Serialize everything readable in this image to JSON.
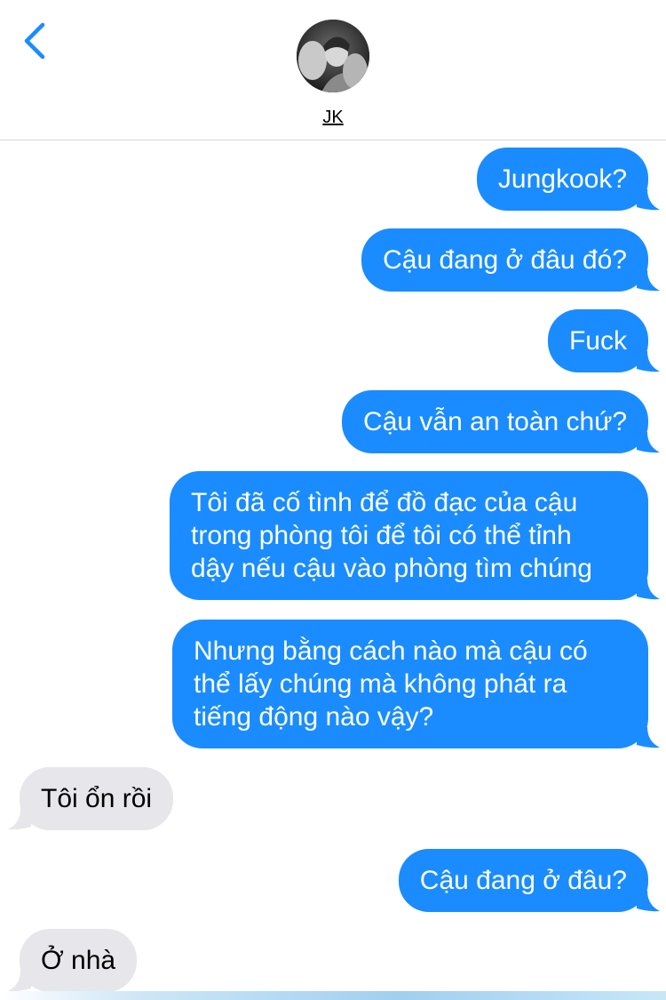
{
  "header": {
    "contact_name": "JK",
    "back_icon": "chevron-left-icon",
    "accent_color": "#1a8cff"
  },
  "messages": [
    {
      "direction": "outgoing",
      "text": "Jungkook?"
    },
    {
      "direction": "outgoing",
      "text": "Cậu đang ở đâu đó?"
    },
    {
      "direction": "outgoing",
      "text": "Fuck"
    },
    {
      "direction": "outgoing",
      "text": "Cậu vẫn an toàn chứ?"
    },
    {
      "direction": "outgoing",
      "lines": [
        "Tôi đã cố tình để đồ đạc của cậu",
        "trong phòng tôi để tôi có thể tỉnh",
        "dậy nếu cậu vào phòng tìm chúng"
      ]
    },
    {
      "direction": "outgoing",
      "lines": [
        "Nhưng bằng cách nào mà cậu có",
        "thể lấy chúng mà không phát ra",
        "tiếng động nào vậy?"
      ]
    },
    {
      "direction": "incoming",
      "text": "Tôi ổn rồi"
    },
    {
      "direction": "outgoing",
      "text": "Cậu đang ở đâu?"
    },
    {
      "direction": "incoming",
      "text": "Ở nhà"
    }
  ],
  "colors": {
    "outgoing_bubble": "#1a8cff",
    "incoming_bubble": "#e6e6eb"
  }
}
